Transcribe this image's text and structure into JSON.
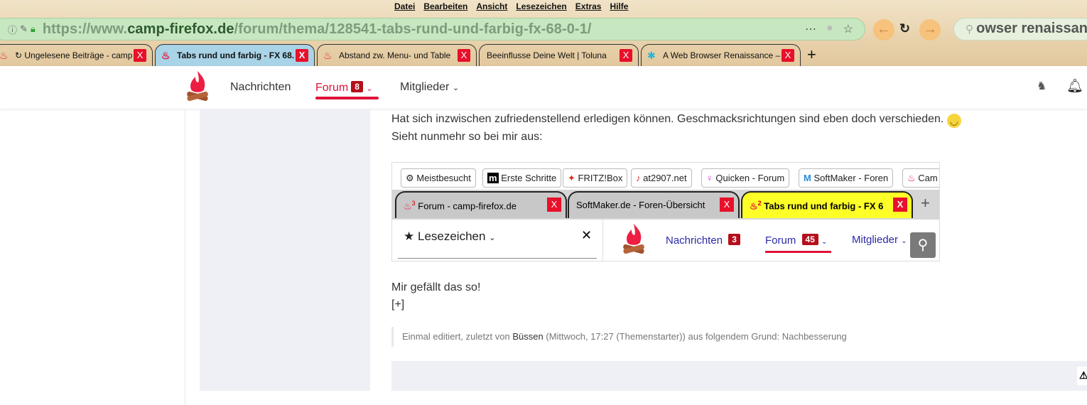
{
  "menu": [
    "Datei",
    "Bearbeiten",
    "Ansicht",
    "Lesezeichen",
    "Extras",
    "Hilfe"
  ],
  "url": {
    "prefix": "https://www.",
    "domain": "camp-firefox.de",
    "path": "/forum/thema/128541-tabs-rund-und-farbig-fx-68-0-1/"
  },
  "search": {
    "value": "owser renaissan"
  },
  "tabs": [
    {
      "label": "↻ Ungelesene Beiträge - camp"
    },
    {
      "label": "Tabs rund und farbig - FX 68.",
      "active": true
    },
    {
      "label": "Abstand zw. Menu- und Table"
    },
    {
      "label": "Beeinflusse Deine Welt | Toluna"
    },
    {
      "label": "A Web Browser Renaissance –"
    }
  ],
  "header": {
    "nav": [
      {
        "label": "Nachrichten"
      },
      {
        "label": "Forum",
        "badge": "8"
      },
      {
        "label": "Mitglieder"
      }
    ]
  },
  "post": {
    "line1": "Hat sich inzwischen zufriedenstellend erledigen können. Geschmacksrichtungen sind eben doch verschieden.",
    "line2": "Sieht nunmehr so bei mir aus:",
    "line3": "Mir gefällt das so!",
    "expand": "[+]",
    "edit_prefix": "Einmal editiert, zuletzt von",
    "edit_user": "Büssen",
    "edit_suffix": "(Mittwoch, 17:27 (Themenstarter)) aus folgendem Grund: Nachbesserung"
  },
  "screenshot": {
    "bookmarks": [
      "Meistbesucht",
      "Erste Schritte",
      "FRITZ!Box",
      "at2907.net",
      "Quicken - Forum",
      "SoftMaker - Foren",
      "Cam"
    ],
    "tabs": [
      "Forum - camp-firefox.de",
      "SoftMaker.de - Foren-Übersicht",
      "Tabs rund und farbig - FX 6"
    ],
    "tab_badges": [
      "3",
      "",
      "2"
    ],
    "sidebar_title": "Lesezeichen",
    "nav": [
      {
        "label": "Nachrichten",
        "badge": "3"
      },
      {
        "label": "Forum",
        "badge": "45"
      },
      {
        "label": "Mitglieder"
      }
    ]
  }
}
